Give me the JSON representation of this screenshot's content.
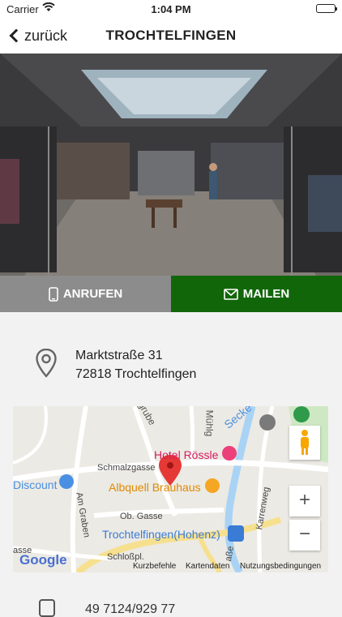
{
  "status_bar": {
    "carrier": "Carrier",
    "time": "1:04 PM"
  },
  "nav": {
    "back_label": "zurück",
    "title": "TROCHTELFINGEN"
  },
  "actions": {
    "call_label": "ANRUFEN",
    "mail_label": "MAILEN"
  },
  "address": {
    "street": "Marktstraße 31",
    "city": "72818 Trochtelfingen"
  },
  "map": {
    "labels": {
      "hotel": "Hotel Rössle",
      "brauhaus": "Albquell Brauhaus",
      "discount": "Discount",
      "schmalzgasse": "Schmalzgasse",
      "ob_gasse": "Ob. Gasse",
      "am_graben": "Am Graben",
      "station": "Trochtelfingen(Hohenz)",
      "schlosspl": "Schloßpl.",
      "karrenweg": "Karrenweg",
      "muehlg": "Mühlg",
      "grube": "grube",
      "secke": "Secke",
      "gasse": "asse",
      "strasse": "aße"
    },
    "google": "Google",
    "attribution": {
      "shortcuts": "Kurzbefehle",
      "mapdata": "Kartendaten",
      "terms": "Nutzungsbedingungen"
    },
    "zoom_in": "+",
    "zoom_out": "−"
  },
  "phone": {
    "number": "49 7124/929 77"
  },
  "colors": {
    "mail_green": "#12660a",
    "call_gray": "#8c8c8c",
    "pin_red": "#e53935"
  }
}
